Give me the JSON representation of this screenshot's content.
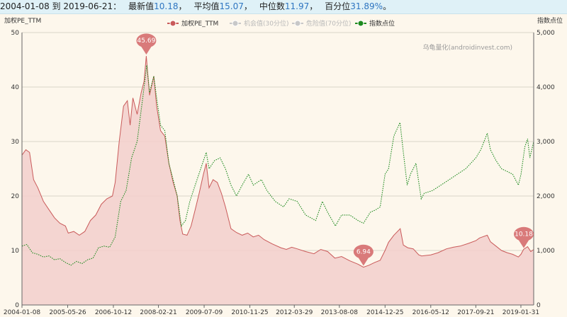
{
  "summary": {
    "date_range": "2004-01-08 到 2019-06-21：",
    "latest_label": "最新值",
    "latest_value": "10.18",
    "sep1": "，",
    "mean_label": "平均值",
    "mean_value": "15.07",
    "sep2": "，",
    "median_label": "中位数",
    "median_value": "11.97",
    "sep3": "，",
    "pct_label": "百分位",
    "pct_value": "31.89%",
    "end": "。"
  },
  "watermark": "乌龟量化(androidinvest.com)",
  "colors": {
    "pe": "#c95a5a",
    "pe_fill": "#f2cfcc",
    "index": "#1e8a1e",
    "legend_off": "#c8c8c8",
    "grid": "#d9d4c8",
    "pin": "#d97a7a"
  },
  "chart_data": {
    "type": "area",
    "title": "",
    "left_axis": {
      "label": "加权PE_TTM",
      "ylim": [
        0,
        50
      ],
      "ticks": [
        "0",
        "10",
        "20",
        "30",
        "40",
        "50"
      ]
    },
    "right_axis": {
      "label": "指数点位",
      "ylim": [
        0,
        5000
      ],
      "ticks": [
        "0",
        "1,000",
        "2,000",
        "3,000",
        "4,000",
        "5,000"
      ]
    },
    "x_ticks": [
      "2004-01-08",
      "2005-05-26",
      "2006-10-12",
      "2008-02-21",
      "2009-07-09",
      "2010-11-25",
      "2012-03-29",
      "2013-08-08",
      "2014-12-25",
      "2016-05-12",
      "2017-09-21",
      "2019-01-31"
    ],
    "legend": [
      {
        "name": "加权PE_TTM",
        "active": true,
        "icon": "circle-icon"
      },
      {
        "name": "机会值(30分位)",
        "active": false,
        "icon": "circle-icon"
      },
      {
        "name": "危险值(70分位)",
        "active": false,
        "icon": "circle-icon"
      },
      {
        "name": "指数点位",
        "active": true,
        "icon": "circle-icon"
      }
    ],
    "series": [
      {
        "name": "加权PE_TTM",
        "axis": "left",
        "style": "area",
        "points": [
          [
            "2004-01-08",
            27.5
          ],
          [
            "2004-02-20",
            28.5
          ],
          [
            "2004-04-01",
            28.0
          ],
          [
            "2004-05-15",
            23.0
          ],
          [
            "2004-07-01",
            21.5
          ],
          [
            "2004-09-01",
            19.0
          ],
          [
            "2004-11-01",
            17.5
          ],
          [
            "2005-01-01",
            16.0
          ],
          [
            "2005-03-01",
            15.0
          ],
          [
            "2005-05-01",
            14.5
          ],
          [
            "2005-06-01",
            13.2
          ],
          [
            "2005-08-01",
            13.5
          ],
          [
            "2005-10-01",
            12.8
          ],
          [
            "2005-12-01",
            13.5
          ],
          [
            "2006-02-01",
            15.5
          ],
          [
            "2006-04-01",
            16.5
          ],
          [
            "2006-06-01",
            18.5
          ],
          [
            "2006-08-01",
            19.5
          ],
          [
            "2006-10-01",
            20.0
          ],
          [
            "2006-11-01",
            22.5
          ],
          [
            "2006-12-15",
            30.0
          ],
          [
            "2007-02-01",
            36.5
          ],
          [
            "2007-03-15",
            37.5
          ],
          [
            "2007-04-15",
            33.0
          ],
          [
            "2007-05-15",
            38.0
          ],
          [
            "2007-07-01",
            35.0
          ],
          [
            "2007-08-15",
            39.0
          ],
          [
            "2007-09-15",
            41.0
          ],
          [
            "2007-10-10",
            45.69
          ],
          [
            "2007-11-15",
            38.5
          ],
          [
            "2008-01-01",
            42.0
          ],
          [
            "2008-02-01",
            36.5
          ],
          [
            "2008-03-15",
            32.0
          ],
          [
            "2008-05-01",
            31.0
          ],
          [
            "2008-06-15",
            26.0
          ],
          [
            "2008-08-01",
            22.5
          ],
          [
            "2008-09-15",
            20.0
          ],
          [
            "2008-10-15",
            15.5
          ],
          [
            "2008-11-15",
            13.0
          ],
          [
            "2009-01-01",
            12.8
          ],
          [
            "2009-02-15",
            14.5
          ],
          [
            "2009-04-01",
            17.5
          ],
          [
            "2009-05-15",
            20.5
          ],
          [
            "2009-07-01",
            24.0
          ],
          [
            "2009-08-01",
            26.0
          ],
          [
            "2009-09-01",
            21.5
          ],
          [
            "2009-10-15",
            23.0
          ],
          [
            "2009-12-01",
            22.5
          ],
          [
            "2010-01-15",
            20.5
          ],
          [
            "2010-03-01",
            18.0
          ],
          [
            "2010-05-01",
            14.0
          ],
          [
            "2010-07-01",
            13.3
          ],
          [
            "2010-09-01",
            12.8
          ],
          [
            "2010-11-01",
            13.2
          ],
          [
            "2011-01-01",
            12.5
          ],
          [
            "2011-03-01",
            12.8
          ],
          [
            "2011-05-01",
            12.0
          ],
          [
            "2011-08-01",
            11.2
          ],
          [
            "2011-11-01",
            10.5
          ],
          [
            "2012-01-01",
            10.2
          ],
          [
            "2012-03-01",
            10.6
          ],
          [
            "2012-05-01",
            10.3
          ],
          [
            "2012-08-01",
            9.8
          ],
          [
            "2012-11-01",
            9.4
          ],
          [
            "2013-01-15",
            10.2
          ],
          [
            "2013-04-01",
            9.8
          ],
          [
            "2013-06-20",
            8.6
          ],
          [
            "2013-09-01",
            8.9
          ],
          [
            "2013-12-01",
            8.1
          ],
          [
            "2014-03-01",
            7.5
          ],
          [
            "2014-05-01",
            6.94
          ],
          [
            "2014-07-01",
            7.3
          ],
          [
            "2014-09-01",
            7.8
          ],
          [
            "2014-11-01",
            8.2
          ],
          [
            "2014-12-25",
            10.0
          ],
          [
            "2015-02-01",
            11.5
          ],
          [
            "2015-04-01",
            12.8
          ],
          [
            "2015-06-10",
            14.0
          ],
          [
            "2015-07-15",
            11.0
          ],
          [
            "2015-09-01",
            10.5
          ],
          [
            "2015-11-01",
            10.3
          ],
          [
            "2016-01-01",
            9.2
          ],
          [
            "2016-02-01",
            9.0
          ],
          [
            "2016-05-12",
            9.2
          ],
          [
            "2016-08-01",
            9.6
          ],
          [
            "2016-11-01",
            10.3
          ],
          [
            "2017-01-15",
            10.6
          ],
          [
            "2017-04-01",
            10.8
          ],
          [
            "2017-07-01",
            11.3
          ],
          [
            "2017-09-21",
            11.8
          ],
          [
            "2017-11-01",
            12.3
          ],
          [
            "2018-01-25",
            12.8
          ],
          [
            "2018-03-01",
            11.6
          ],
          [
            "2018-05-01",
            10.8
          ],
          [
            "2018-07-01",
            10.0
          ],
          [
            "2018-09-01",
            9.6
          ],
          [
            "2018-11-01",
            9.3
          ],
          [
            "2019-01-03",
            8.8
          ],
          [
            "2019-01-31",
            9.3
          ],
          [
            "2019-03-01",
            10.2
          ],
          [
            "2019-04-15",
            10.7
          ],
          [
            "2019-05-20",
            9.8
          ],
          [
            "2019-06-21",
            10.18
          ]
        ],
        "markers": [
          {
            "date": "2007-10-10",
            "value": 45.69,
            "label": "45.69"
          },
          {
            "date": "2014-05-01",
            "value": 6.94,
            "label": "6.94"
          },
          {
            "date": "2019-06-21",
            "value": 10.18,
            "label": "10.18"
          }
        ]
      },
      {
        "name": "指数点位",
        "axis": "right",
        "style": "dotted-line",
        "points": [
          [
            "2004-01-08",
            1080
          ],
          [
            "2004-03-01",
            1110
          ],
          [
            "2004-05-01",
            960
          ],
          [
            "2004-07-01",
            930
          ],
          [
            "2004-09-01",
            880
          ],
          [
            "2004-11-01",
            900
          ],
          [
            "2005-01-01",
            830
          ],
          [
            "2005-03-01",
            850
          ],
          [
            "2005-05-01",
            780
          ],
          [
            "2005-07-01",
            730
          ],
          [
            "2005-09-01",
            800
          ],
          [
            "2005-11-01",
            760
          ],
          [
            "2006-01-01",
            830
          ],
          [
            "2006-03-01",
            860
          ],
          [
            "2006-05-01",
            1050
          ],
          [
            "2006-07-01",
            1080
          ],
          [
            "2006-09-01",
            1060
          ],
          [
            "2006-11-01",
            1250
          ],
          [
            "2007-01-01",
            1900
          ],
          [
            "2007-03-01",
            2100
          ],
          [
            "2007-05-01",
            2700
          ],
          [
            "2007-07-01",
            3000
          ],
          [
            "2007-09-01",
            3800
          ],
          [
            "2007-10-15",
            4400
          ],
          [
            "2007-11-15",
            3900
          ],
          [
            "2008-01-01",
            4200
          ],
          [
            "2008-02-01",
            3800
          ],
          [
            "2008-03-15",
            3300
          ],
          [
            "2008-05-01",
            3200
          ],
          [
            "2008-06-15",
            2600
          ],
          [
            "2008-08-01",
            2300
          ],
          [
            "2008-09-15",
            2000
          ],
          [
            "2008-10-31",
            1450
          ],
          [
            "2008-12-15",
            1550
          ],
          [
            "2009-02-01",
            1900
          ],
          [
            "2009-04-01",
            2200
          ],
          [
            "2009-06-01",
            2500
          ],
          [
            "2009-08-01",
            2800
          ],
          [
            "2009-09-01",
            2500
          ],
          [
            "2009-11-01",
            2650
          ],
          [
            "2010-01-01",
            2700
          ],
          [
            "2010-03-01",
            2500
          ],
          [
            "2010-05-01",
            2200
          ],
          [
            "2010-07-01",
            2000
          ],
          [
            "2010-09-01",
            2200
          ],
          [
            "2010-11-10",
            2400
          ],
          [
            "2011-01-01",
            2200
          ],
          [
            "2011-04-01",
            2300
          ],
          [
            "2011-06-01",
            2100
          ],
          [
            "2011-09-01",
            1900
          ],
          [
            "2011-12-01",
            1800
          ],
          [
            "2012-02-01",
            1950
          ],
          [
            "2012-05-01",
            1900
          ],
          [
            "2012-08-01",
            1650
          ],
          [
            "2012-11-20",
            1550
          ],
          [
            "2013-02-01",
            1900
          ],
          [
            "2013-04-01",
            1700
          ],
          [
            "2013-06-25",
            1450
          ],
          [
            "2013-09-01",
            1650
          ],
          [
            "2013-12-01",
            1650
          ],
          [
            "2014-03-01",
            1550
          ],
          [
            "2014-05-01",
            1500
          ],
          [
            "2014-07-15",
            1700
          ],
          [
            "2014-09-15",
            1750
          ],
          [
            "2014-11-01",
            1800
          ],
          [
            "2014-12-25",
            2400
          ],
          [
            "2015-02-01",
            2500
          ],
          [
            "2015-04-01",
            3100
          ],
          [
            "2015-06-08",
            3350
          ],
          [
            "2015-07-15",
            2800
          ],
          [
            "2015-08-26",
            2200
          ],
          [
            "2015-10-01",
            2400
          ],
          [
            "2015-12-01",
            2600
          ],
          [
            "2016-01-28",
            1950
          ],
          [
            "2016-03-01",
            2050
          ],
          [
            "2016-06-01",
            2100
          ],
          [
            "2016-09-01",
            2200
          ],
          [
            "2016-12-01",
            2300
          ],
          [
            "2017-03-01",
            2400
          ],
          [
            "2017-06-01",
            2500
          ],
          [
            "2017-09-21",
            2700
          ],
          [
            "2017-11-15",
            2850
          ],
          [
            "2018-01-25",
            3150
          ],
          [
            "2018-03-01",
            2850
          ],
          [
            "2018-05-01",
            2650
          ],
          [
            "2018-07-01",
            2500
          ],
          [
            "2018-09-01",
            2450
          ],
          [
            "2018-11-01",
            2400
          ],
          [
            "2019-01-03",
            2200
          ],
          [
            "2019-02-01",
            2400
          ],
          [
            "2019-03-15",
            2900
          ],
          [
            "2019-04-15",
            3050
          ],
          [
            "2019-05-10",
            2700
          ],
          [
            "2019-06-21",
            3000
          ]
        ]
      }
    ]
  }
}
